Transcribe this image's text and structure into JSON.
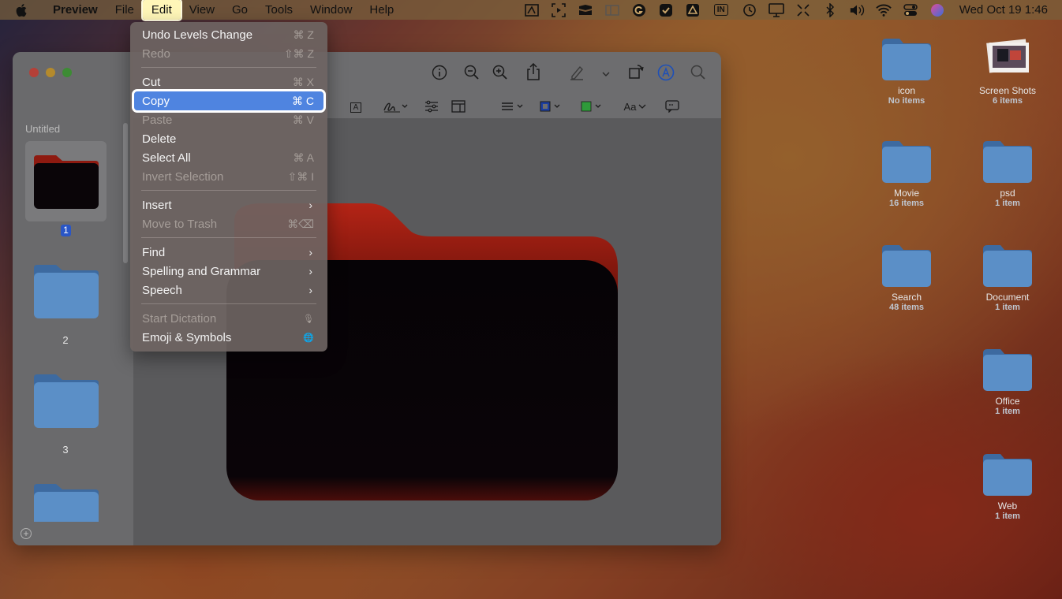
{
  "menubar": {
    "app_name": "Preview",
    "menus": [
      "File",
      "Edit",
      "View",
      "Go",
      "Tools",
      "Window",
      "Help"
    ],
    "active_menu": "Edit",
    "clock": "Wed Oct 19  1:46",
    "keyboard_badge": "IN"
  },
  "edit_menu": {
    "items": [
      {
        "label": "Undo Levels Change",
        "shortcut": "⌘ Z",
        "enabled": true
      },
      {
        "label": "Redo",
        "shortcut": "⇧⌘ Z",
        "enabled": false
      },
      {
        "label": "Cut",
        "shortcut": "⌘ X",
        "enabled": true
      },
      {
        "label": "Copy",
        "shortcut": "⌘ C",
        "enabled": true,
        "highlighted": true
      },
      {
        "label": "Paste",
        "shortcut": "⌘ V",
        "enabled": false
      },
      {
        "label": "Delete",
        "shortcut": "",
        "enabled": true
      },
      {
        "label": "Select All",
        "shortcut": "⌘ A",
        "enabled": true
      },
      {
        "label": "Invert Selection",
        "shortcut": "⇧⌘ I",
        "enabled": false
      },
      {
        "label": "Insert",
        "submenu": true,
        "enabled": true
      },
      {
        "label": "Move to Trash",
        "shortcut": "⌘⌫",
        "enabled": false
      },
      {
        "label": "Find",
        "submenu": true,
        "enabled": true
      },
      {
        "label": "Spelling and Grammar",
        "submenu": true,
        "enabled": true
      },
      {
        "label": "Speech",
        "submenu": true,
        "enabled": true
      },
      {
        "label": "Start Dictation",
        "shortcut": "🎙",
        "enabled": false
      },
      {
        "label": "Emoji & Symbols",
        "shortcut": "🌐",
        "enabled": true
      }
    ]
  },
  "preview_window": {
    "sidebar_title": "Untitled",
    "pages": [
      "1",
      "2",
      "3"
    ],
    "selected_page": "1",
    "add_button": "+",
    "toolbar": {
      "text_tool": "A",
      "font_button": "Aa"
    }
  },
  "desktop": {
    "icons": [
      {
        "name": "icon",
        "count": "No items"
      },
      {
        "name": "Screen Shots",
        "count": "6 items"
      },
      {
        "name": "Movie",
        "count": "16 items"
      },
      {
        "name": "psd",
        "count": "1 item"
      },
      {
        "name": "Search",
        "count": "48 items"
      },
      {
        "name": "Document",
        "count": "1 item"
      },
      {
        "name": "Office",
        "count": "1 item"
      },
      {
        "name": "Web",
        "count": "1 item"
      }
    ]
  },
  "colors": {
    "menu_highlight": "#4f84e0",
    "folder_blue": "#5b8fc7",
    "folder_red": "#8a1a12"
  }
}
